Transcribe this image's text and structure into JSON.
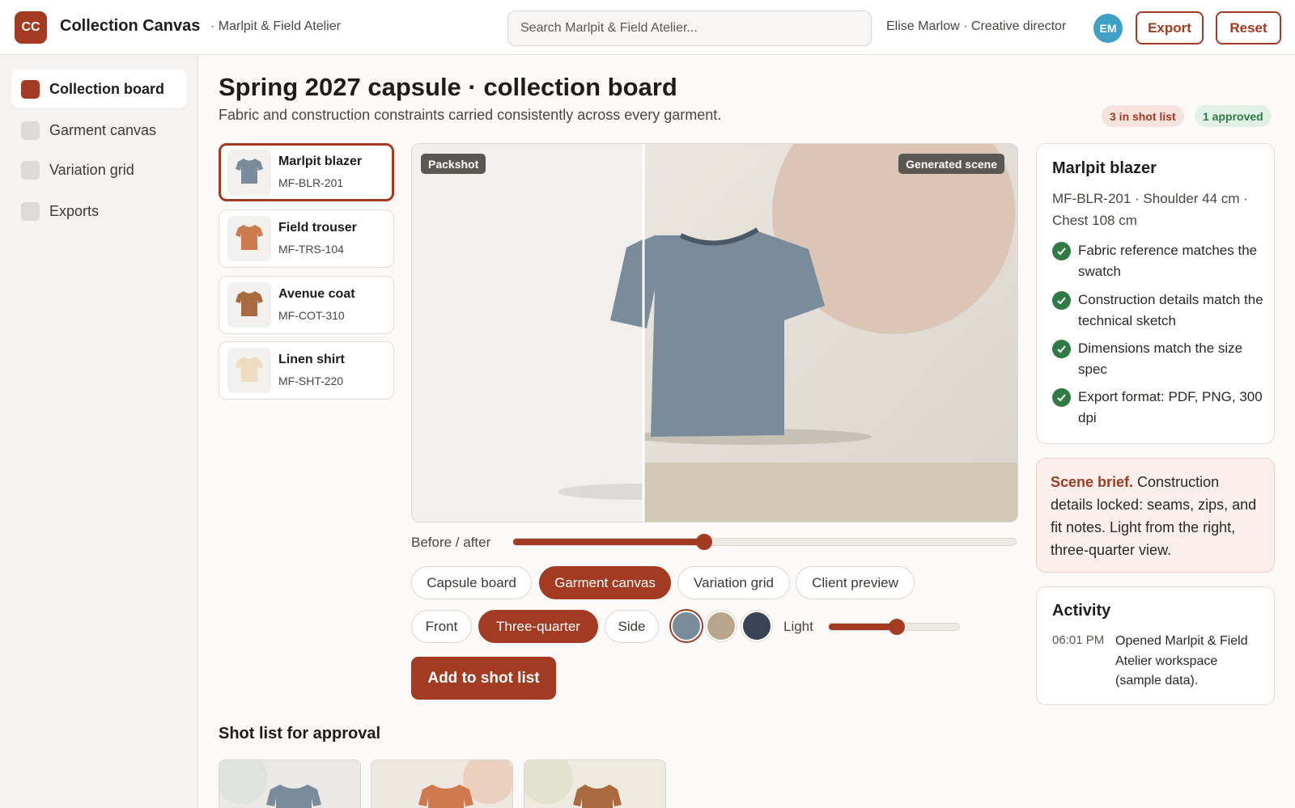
{
  "app": {
    "logo_text": "CC",
    "title": "Collection Canvas",
    "workspace": "· Marlpit & Field Atelier",
    "search_placeholder": "Search Marlpit & Field Atelier...",
    "user": "Elise Marlow · Creative director",
    "avatar": "EM",
    "export_label": "Export",
    "reset_label": "Reset"
  },
  "sidebar": {
    "items": [
      {
        "label": "Collection board",
        "active": true
      },
      {
        "label": "Garment canvas",
        "active": false
      },
      {
        "label": "Variation grid",
        "active": false
      },
      {
        "label": "Exports",
        "active": false
      }
    ]
  },
  "header": {
    "title": "Spring 2027 capsule · collection board",
    "subtitle": "Fabric and construction constraints carried consistently across every garment.",
    "badge_shot": "3 in shot list",
    "badge_approved": "1 approved"
  },
  "garments": [
    {
      "name": "Marlpit blazer",
      "code": "MF-BLR-201",
      "color": "#7a8c9b",
      "selected": true
    },
    {
      "name": "Field trouser",
      "code": "MF-TRS-104",
      "color": "#cc7a4e",
      "selected": false
    },
    {
      "name": "Avenue coat",
      "code": "MF-COT-310",
      "color": "#a86a3e",
      "selected": false
    },
    {
      "name": "Linen shirt",
      "code": "MF-SHT-220",
      "color": "#eedcc0",
      "selected": false
    }
  ],
  "canvas": {
    "tag_left": "Packshot",
    "tag_right": "Generated scene",
    "before_after_label": "Before / after",
    "before_after_value": 0.38
  },
  "view_tabs": [
    {
      "label": "Capsule board",
      "active": false
    },
    {
      "label": "Garment canvas",
      "active": true
    },
    {
      "label": "Variation grid",
      "active": false
    },
    {
      "label": "Client preview",
      "active": false
    }
  ],
  "angles": [
    {
      "label": "Front",
      "active": false
    },
    {
      "label": "Three-quarter",
      "active": true
    },
    {
      "label": "Side",
      "active": false
    }
  ],
  "swatches": [
    {
      "color": "#7a8c9b",
      "selected": true
    },
    {
      "color": "#b8a58a",
      "selected": false
    },
    {
      "color": "#3a4257",
      "selected": false
    }
  ],
  "light": {
    "label": "Light",
    "value": 0.52
  },
  "add_button": "Add to shot list",
  "shot_list": {
    "title": "Shot list for approval",
    "items": [
      {
        "color": "#7a8c9b",
        "bg": "#ebe9e5",
        "circle": "#dfe3de"
      },
      {
        "color": "#cc7a4e",
        "bg": "#efe8e1",
        "circle": "#ecd0bf"
      },
      {
        "color": "#a86a3e",
        "bg": "#efeadf",
        "circle": "#e2e3cf"
      }
    ]
  },
  "spec": {
    "title": "Marlpit blazer",
    "meta": "MF-BLR-201 · Shoulder 44 cm · Chest 108 cm",
    "checks": [
      "Fabric reference matches the swatch",
      "Construction details match the technical sketch",
      "Dimensions match the size spec",
      "Export format: PDF, PNG, 300 dpi"
    ]
  },
  "brief": {
    "lead": "Scene brief.",
    "text": " Construction details locked: seams, zips, and fit notes. Light from the right, three-quarter view."
  },
  "activity": {
    "title": "Activity",
    "time": "06:01 PM",
    "text": "Opened Marlpit & Field Atelier workspace (sample data)."
  }
}
